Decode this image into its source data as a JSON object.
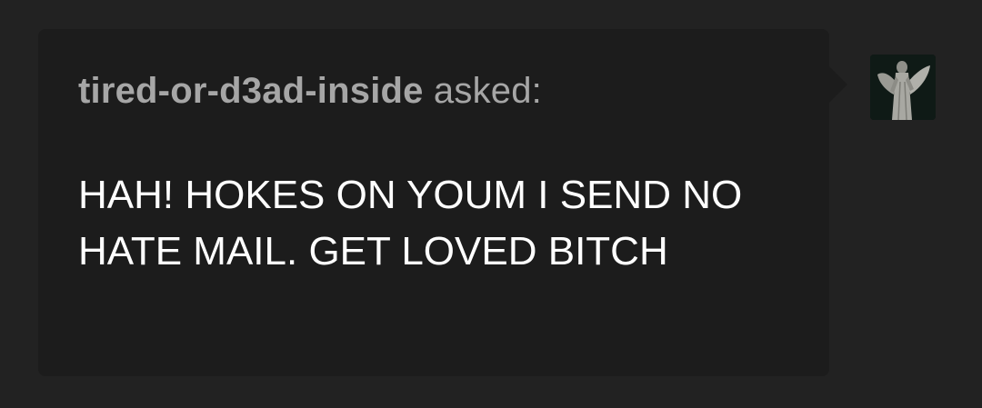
{
  "ask": {
    "asker_name": "tired-or-d3ad-inside",
    "verb": "asked:",
    "question": "HAH! HOKES ON YOUM I SEND NO HATE MAIL. GET LOVED BITCH"
  },
  "avatar": {
    "icon": "angel-statue-avatar-icon"
  },
  "colors": {
    "page_background": "#222222",
    "bubble_background": "#1c1c1c",
    "asker_text": "#a6a6a6",
    "question_text": "#ffffff"
  }
}
